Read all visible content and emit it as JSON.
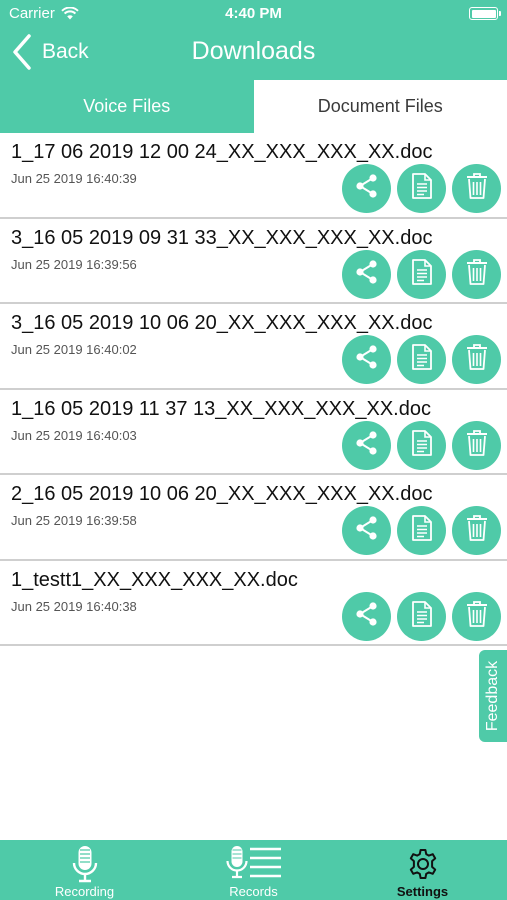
{
  "status_bar": {
    "carrier": "Carrier",
    "time": "4:40 PM"
  },
  "nav": {
    "back_label": "Back",
    "title": "Downloads"
  },
  "tabs": [
    {
      "label": "Voice Files",
      "active": false
    },
    {
      "label": "Document Files",
      "active": true
    }
  ],
  "files": [
    {
      "name": "1_17 06 2019 12 00 24_XX_XXX_XXX_XX.doc",
      "date": "Jun 25 2019 16:40:39"
    },
    {
      "name": "3_16 05 2019 09 31 33_XX_XXX_XXX_XX.doc",
      "date": "Jun 25 2019 16:39:56"
    },
    {
      "name": "3_16 05 2019 10 06 20_XX_XXX_XXX_XX.doc",
      "date": "Jun 25 2019 16:40:02"
    },
    {
      "name": "1_16 05 2019 11 37 13_XX_XXX_XXX_XX.doc",
      "date": "Jun 25 2019 16:40:03"
    },
    {
      "name": "2_16 05 2019 10 06 20_XX_XXX_XXX_XX.doc",
      "date": "Jun 25 2019 16:39:58"
    },
    {
      "name": "1_testt1_XX_XXX_XXX_XX.doc",
      "date": "Jun 25 2019 16:40:38"
    }
  ],
  "feedback_label": "Feedback",
  "bottom_bar": [
    {
      "label": "Recording",
      "icon": "microphone-icon"
    },
    {
      "label": "Records",
      "icon": "records-list-icon"
    },
    {
      "label": "Settings",
      "icon": "gear-icon",
      "selected": true
    }
  ],
  "colors": {
    "accent": "#4fcaa8",
    "divider": "#cfcfcf",
    "text": "#111111"
  }
}
